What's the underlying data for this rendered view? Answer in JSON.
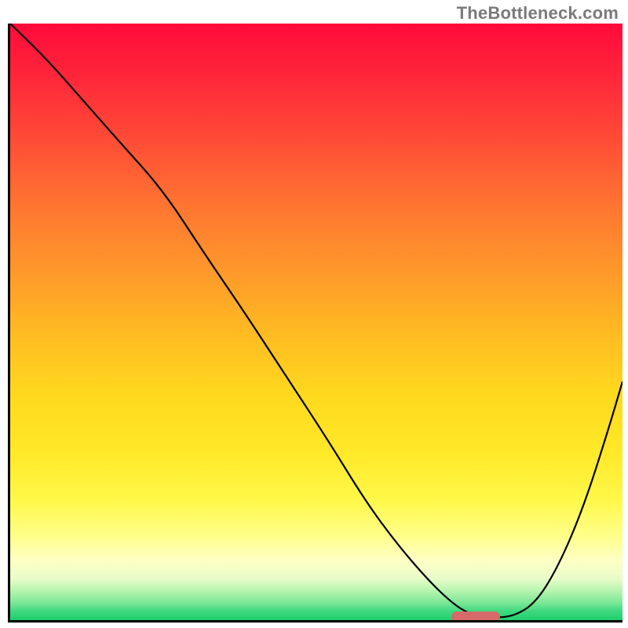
{
  "watermark": "TheBottleneck.com",
  "chart_data": {
    "type": "line",
    "title": "",
    "xlabel": "",
    "ylabel": "",
    "xlim": [
      0,
      100
    ],
    "ylim": [
      0,
      100
    ],
    "grid": false,
    "legend": false,
    "series": [
      {
        "name": "curve",
        "x": [
          0,
          6,
          12,
          18,
          25,
          32,
          38,
          45,
          52,
          58,
          63,
          68,
          72,
          75,
          78,
          82,
          86,
          90,
          94,
          98,
          100
        ],
        "y": [
          100,
          94,
          87,
          80,
          72,
          61,
          52,
          41,
          30,
          20,
          13,
          7,
          3,
          1,
          0.5,
          0.5,
          3,
          10,
          20,
          33,
          40
        ]
      }
    ],
    "marker": {
      "x_start": 72,
      "x_end": 80,
      "y": 0.5
    },
    "gradient_stops": [
      {
        "pct": 0,
        "color": "#ff0a3a"
      },
      {
        "pct": 10,
        "color": "#ff2a3a"
      },
      {
        "pct": 22,
        "color": "#ff5535"
      },
      {
        "pct": 32,
        "color": "#ff7a30"
      },
      {
        "pct": 42,
        "color": "#ff9a2a"
      },
      {
        "pct": 52,
        "color": "#ffbb22"
      },
      {
        "pct": 62,
        "color": "#ffd81e"
      },
      {
        "pct": 72,
        "color": "#ffe928"
      },
      {
        "pct": 80,
        "color": "#fff84a"
      },
      {
        "pct": 86,
        "color": "#ffff8c"
      },
      {
        "pct": 90,
        "color": "#feffc4"
      },
      {
        "pct": 93,
        "color": "#e9fcc8"
      },
      {
        "pct": 95,
        "color": "#b8f5b0"
      },
      {
        "pct": 97,
        "color": "#7ee897"
      },
      {
        "pct": 98.5,
        "color": "#3fd97f"
      },
      {
        "pct": 100,
        "color": "#1ecf6e"
      }
    ]
  }
}
